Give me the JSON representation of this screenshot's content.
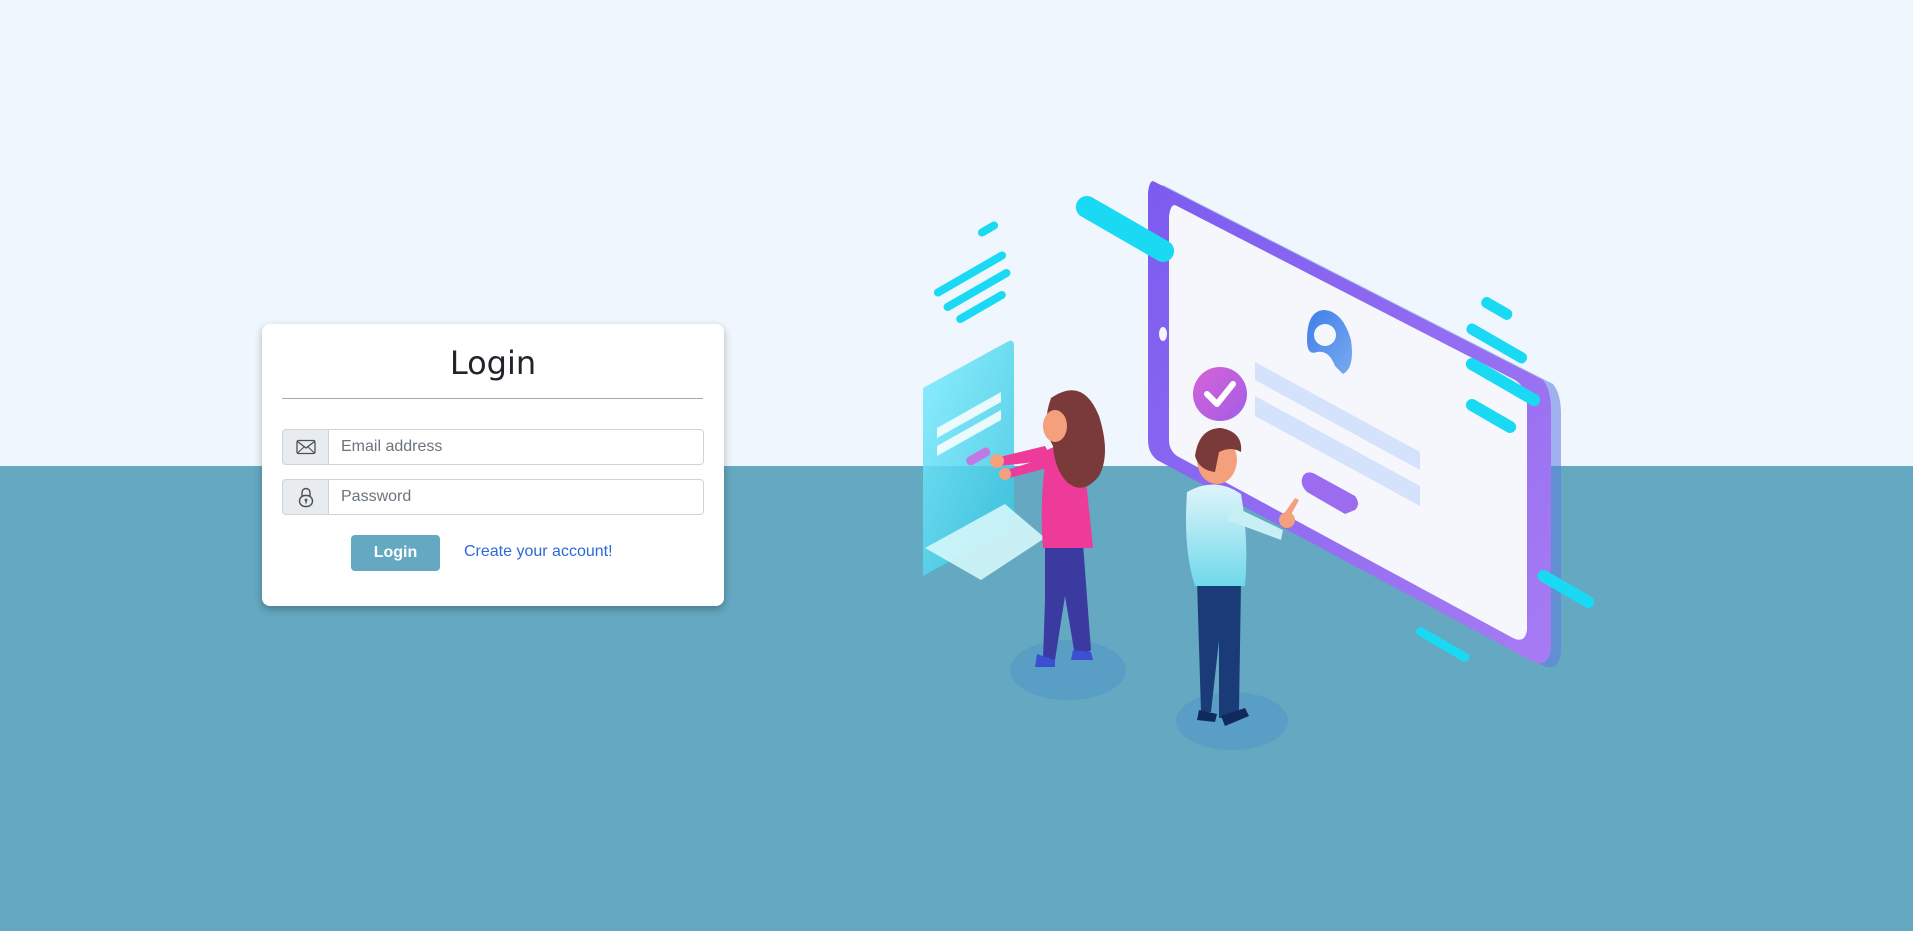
{
  "login_card": {
    "title": "Login",
    "email_placeholder": "Email address",
    "password_placeholder": "Password",
    "login_button_label": "Login",
    "create_account_link": "Create your account!"
  },
  "icons": {
    "email": "envelope-icon",
    "password": "lock-icon"
  },
  "colors": {
    "top_background": "#eff6fd",
    "bottom_background": "#64a8c1",
    "accent": "#64a8c1",
    "link": "#2a6ad8"
  }
}
